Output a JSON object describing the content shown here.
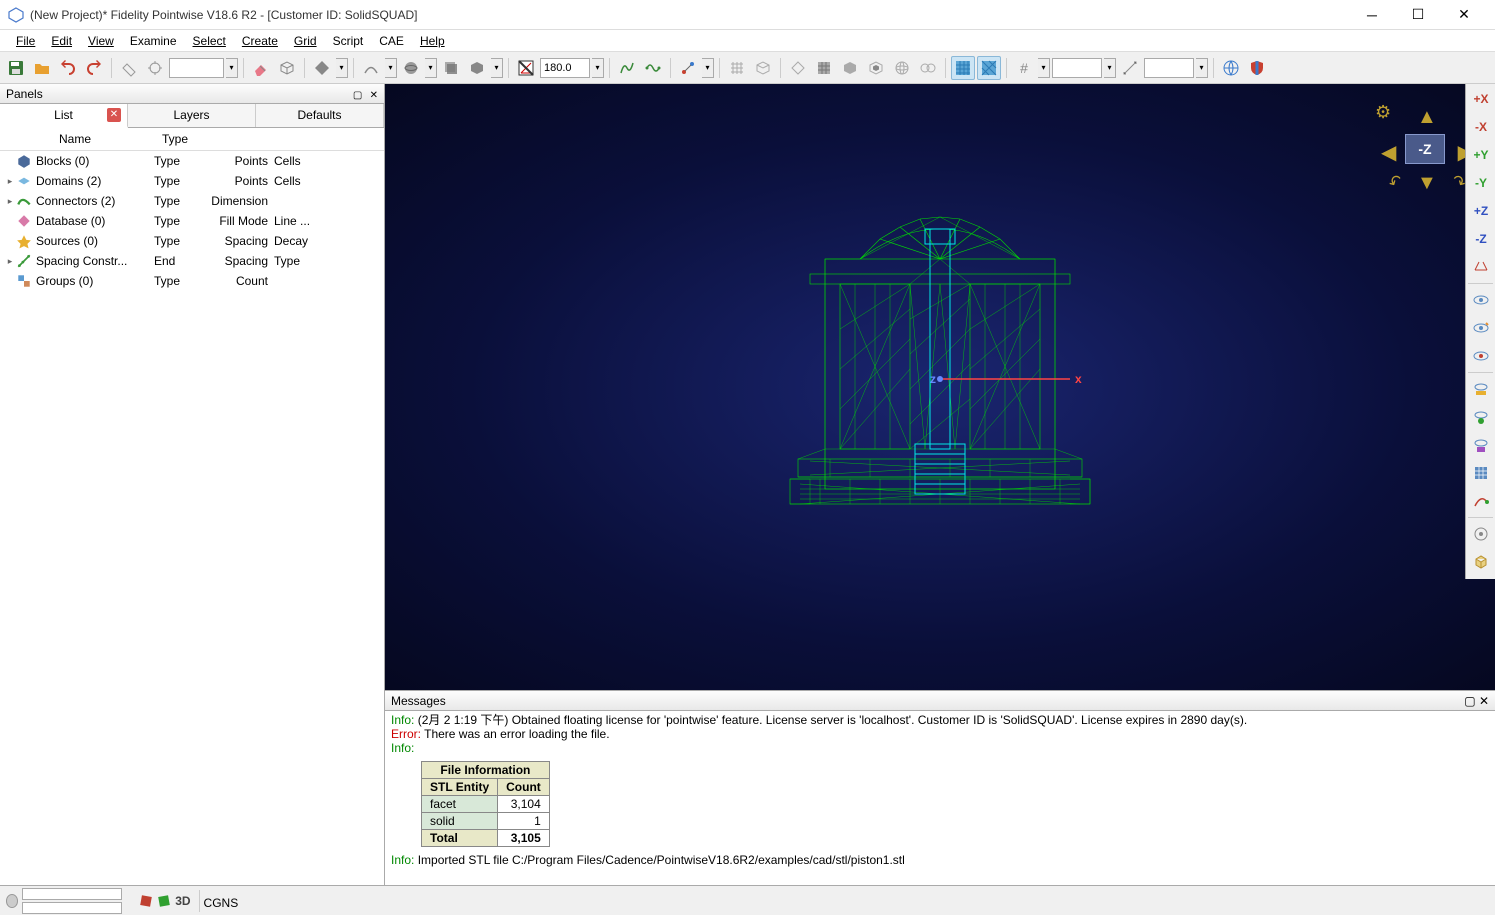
{
  "window": {
    "title": "(New Project)* Fidelity Pointwise V18.6 R2 - [Customer ID: SolidSQUAD]"
  },
  "menu": [
    "File",
    "Edit",
    "View",
    "Examine",
    "Select",
    "Create",
    "Grid",
    "Script",
    "CAE",
    "Help"
  ],
  "toolbar": {
    "angle_value": "180.0"
  },
  "panels": {
    "title": "Panels",
    "tabs": {
      "list": "List",
      "layers": "Layers",
      "defaults": "Defaults"
    },
    "columns": {
      "name": "Name",
      "type": "Type"
    },
    "rows": [
      {
        "expand": "",
        "icon": "block",
        "name": "Blocks (0)",
        "type": "Type",
        "c3": "Points",
        "c4": "Cells"
      },
      {
        "expand": "▸",
        "icon": "domain",
        "name": "Domains (2)",
        "type": "Type",
        "c3": "Points",
        "c4": "Cells"
      },
      {
        "expand": "▸",
        "icon": "connector",
        "name": "Connectors (2)",
        "type": "Type",
        "c3": "Dimension",
        "c4": ""
      },
      {
        "expand": "",
        "icon": "database",
        "name": "Database (0)",
        "type": "Type",
        "c3": "Fill Mode",
        "c4": "Line ..."
      },
      {
        "expand": "",
        "icon": "source",
        "name": "Sources (0)",
        "type": "Type",
        "c3": "Spacing",
        "c4": "Decay"
      },
      {
        "expand": "▸",
        "icon": "spacing",
        "name": "Spacing Constr...",
        "type": "End",
        "c3": "Spacing",
        "c4": "Type"
      },
      {
        "expand": "",
        "icon": "group",
        "name": "Groups (0)",
        "type": "Type",
        "c3": "Count",
        "c4": ""
      }
    ]
  },
  "viewport": {
    "cube_label": "-Z",
    "axis_x": "x",
    "axis_z": "z"
  },
  "right_tb": [
    "+X",
    "-X",
    "+Y",
    "-Y",
    "+Z",
    "-Z"
  ],
  "messages": {
    "title": "Messages",
    "line1_prefix": "Info:",
    "line1_text": " (2月 2 1:19 下午) Obtained floating license for 'pointwise' feature. License server is 'localhost'. Customer ID is 'SolidSQUAD'. License expires in 2890 day(s).",
    "line2_prefix": "Error:",
    "line2_text": " There was an error loading the file.",
    "line3_prefix": "Info:",
    "table": {
      "header": "File Information",
      "col1": "STL Entity",
      "col2": "Count",
      "r1c1": "facet",
      "r1c2": "3,104",
      "r2c1": "solid",
      "r2c2": "1",
      "r3c1": "Total",
      "r3c2": "3,105"
    },
    "line4_prefix": "Info:",
    "line4_text": " Imported STL file C:/Program Files/Cadence/PointwiseV18.6R2/examples/cad/stl/piston1.stl"
  },
  "status": {
    "mode3d": "3D",
    "solver": "CGNS"
  }
}
